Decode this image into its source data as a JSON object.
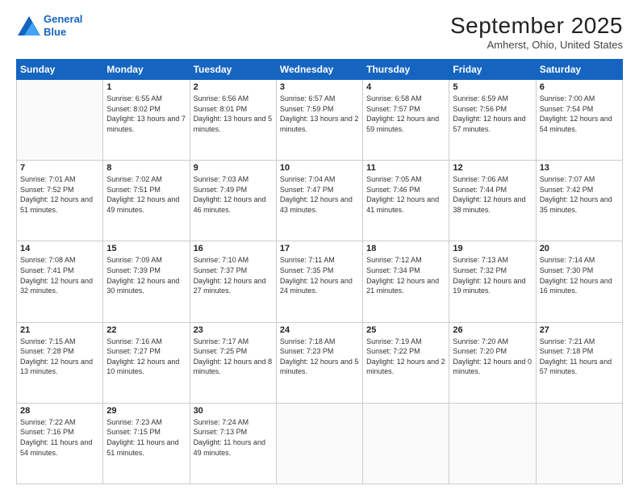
{
  "logo": {
    "line1": "General",
    "line2": "Blue"
  },
  "title": "September 2025",
  "location": "Amherst, Ohio, United States",
  "days_of_week": [
    "Sunday",
    "Monday",
    "Tuesday",
    "Wednesday",
    "Thursday",
    "Friday",
    "Saturday"
  ],
  "weeks": [
    [
      {
        "day": "",
        "sunrise": "",
        "sunset": "",
        "daylight": ""
      },
      {
        "day": "1",
        "sunrise": "Sunrise: 6:55 AM",
        "sunset": "Sunset: 8:02 PM",
        "daylight": "Daylight: 13 hours and 7 minutes."
      },
      {
        "day": "2",
        "sunrise": "Sunrise: 6:56 AM",
        "sunset": "Sunset: 8:01 PM",
        "daylight": "Daylight: 13 hours and 5 minutes."
      },
      {
        "day": "3",
        "sunrise": "Sunrise: 6:57 AM",
        "sunset": "Sunset: 7:59 PM",
        "daylight": "Daylight: 13 hours and 2 minutes."
      },
      {
        "day": "4",
        "sunrise": "Sunrise: 6:58 AM",
        "sunset": "Sunset: 7:57 PM",
        "daylight": "Daylight: 12 hours and 59 minutes."
      },
      {
        "day": "5",
        "sunrise": "Sunrise: 6:59 AM",
        "sunset": "Sunset: 7:56 PM",
        "daylight": "Daylight: 12 hours and 57 minutes."
      },
      {
        "day": "6",
        "sunrise": "Sunrise: 7:00 AM",
        "sunset": "Sunset: 7:54 PM",
        "daylight": "Daylight: 12 hours and 54 minutes."
      }
    ],
    [
      {
        "day": "7",
        "sunrise": "Sunrise: 7:01 AM",
        "sunset": "Sunset: 7:52 PM",
        "daylight": "Daylight: 12 hours and 51 minutes."
      },
      {
        "day": "8",
        "sunrise": "Sunrise: 7:02 AM",
        "sunset": "Sunset: 7:51 PM",
        "daylight": "Daylight: 12 hours and 49 minutes."
      },
      {
        "day": "9",
        "sunrise": "Sunrise: 7:03 AM",
        "sunset": "Sunset: 7:49 PM",
        "daylight": "Daylight: 12 hours and 46 minutes."
      },
      {
        "day": "10",
        "sunrise": "Sunrise: 7:04 AM",
        "sunset": "Sunset: 7:47 PM",
        "daylight": "Daylight: 12 hours and 43 minutes."
      },
      {
        "day": "11",
        "sunrise": "Sunrise: 7:05 AM",
        "sunset": "Sunset: 7:46 PM",
        "daylight": "Daylight: 12 hours and 41 minutes."
      },
      {
        "day": "12",
        "sunrise": "Sunrise: 7:06 AM",
        "sunset": "Sunset: 7:44 PM",
        "daylight": "Daylight: 12 hours and 38 minutes."
      },
      {
        "day": "13",
        "sunrise": "Sunrise: 7:07 AM",
        "sunset": "Sunset: 7:42 PM",
        "daylight": "Daylight: 12 hours and 35 minutes."
      }
    ],
    [
      {
        "day": "14",
        "sunrise": "Sunrise: 7:08 AM",
        "sunset": "Sunset: 7:41 PM",
        "daylight": "Daylight: 12 hours and 32 minutes."
      },
      {
        "day": "15",
        "sunrise": "Sunrise: 7:09 AM",
        "sunset": "Sunset: 7:39 PM",
        "daylight": "Daylight: 12 hours and 30 minutes."
      },
      {
        "day": "16",
        "sunrise": "Sunrise: 7:10 AM",
        "sunset": "Sunset: 7:37 PM",
        "daylight": "Daylight: 12 hours and 27 minutes."
      },
      {
        "day": "17",
        "sunrise": "Sunrise: 7:11 AM",
        "sunset": "Sunset: 7:35 PM",
        "daylight": "Daylight: 12 hours and 24 minutes."
      },
      {
        "day": "18",
        "sunrise": "Sunrise: 7:12 AM",
        "sunset": "Sunset: 7:34 PM",
        "daylight": "Daylight: 12 hours and 21 minutes."
      },
      {
        "day": "19",
        "sunrise": "Sunrise: 7:13 AM",
        "sunset": "Sunset: 7:32 PM",
        "daylight": "Daylight: 12 hours and 19 minutes."
      },
      {
        "day": "20",
        "sunrise": "Sunrise: 7:14 AM",
        "sunset": "Sunset: 7:30 PM",
        "daylight": "Daylight: 12 hours and 16 minutes."
      }
    ],
    [
      {
        "day": "21",
        "sunrise": "Sunrise: 7:15 AM",
        "sunset": "Sunset: 7:28 PM",
        "daylight": "Daylight: 12 hours and 13 minutes."
      },
      {
        "day": "22",
        "sunrise": "Sunrise: 7:16 AM",
        "sunset": "Sunset: 7:27 PM",
        "daylight": "Daylight: 12 hours and 10 minutes."
      },
      {
        "day": "23",
        "sunrise": "Sunrise: 7:17 AM",
        "sunset": "Sunset: 7:25 PM",
        "daylight": "Daylight: 12 hours and 8 minutes."
      },
      {
        "day": "24",
        "sunrise": "Sunrise: 7:18 AM",
        "sunset": "Sunset: 7:23 PM",
        "daylight": "Daylight: 12 hours and 5 minutes."
      },
      {
        "day": "25",
        "sunrise": "Sunrise: 7:19 AM",
        "sunset": "Sunset: 7:22 PM",
        "daylight": "Daylight: 12 hours and 2 minutes."
      },
      {
        "day": "26",
        "sunrise": "Sunrise: 7:20 AM",
        "sunset": "Sunset: 7:20 PM",
        "daylight": "Daylight: 12 hours and 0 minutes."
      },
      {
        "day": "27",
        "sunrise": "Sunrise: 7:21 AM",
        "sunset": "Sunset: 7:18 PM",
        "daylight": "Daylight: 11 hours and 57 minutes."
      }
    ],
    [
      {
        "day": "28",
        "sunrise": "Sunrise: 7:22 AM",
        "sunset": "Sunset: 7:16 PM",
        "daylight": "Daylight: 11 hours and 54 minutes."
      },
      {
        "day": "29",
        "sunrise": "Sunrise: 7:23 AM",
        "sunset": "Sunset: 7:15 PM",
        "daylight": "Daylight: 11 hours and 51 minutes."
      },
      {
        "day": "30",
        "sunrise": "Sunrise: 7:24 AM",
        "sunset": "Sunset: 7:13 PM",
        "daylight": "Daylight: 11 hours and 49 minutes."
      },
      {
        "day": "",
        "sunrise": "",
        "sunset": "",
        "daylight": ""
      },
      {
        "day": "",
        "sunrise": "",
        "sunset": "",
        "daylight": ""
      },
      {
        "day": "",
        "sunrise": "",
        "sunset": "",
        "daylight": ""
      },
      {
        "day": "",
        "sunrise": "",
        "sunset": "",
        "daylight": ""
      }
    ]
  ]
}
